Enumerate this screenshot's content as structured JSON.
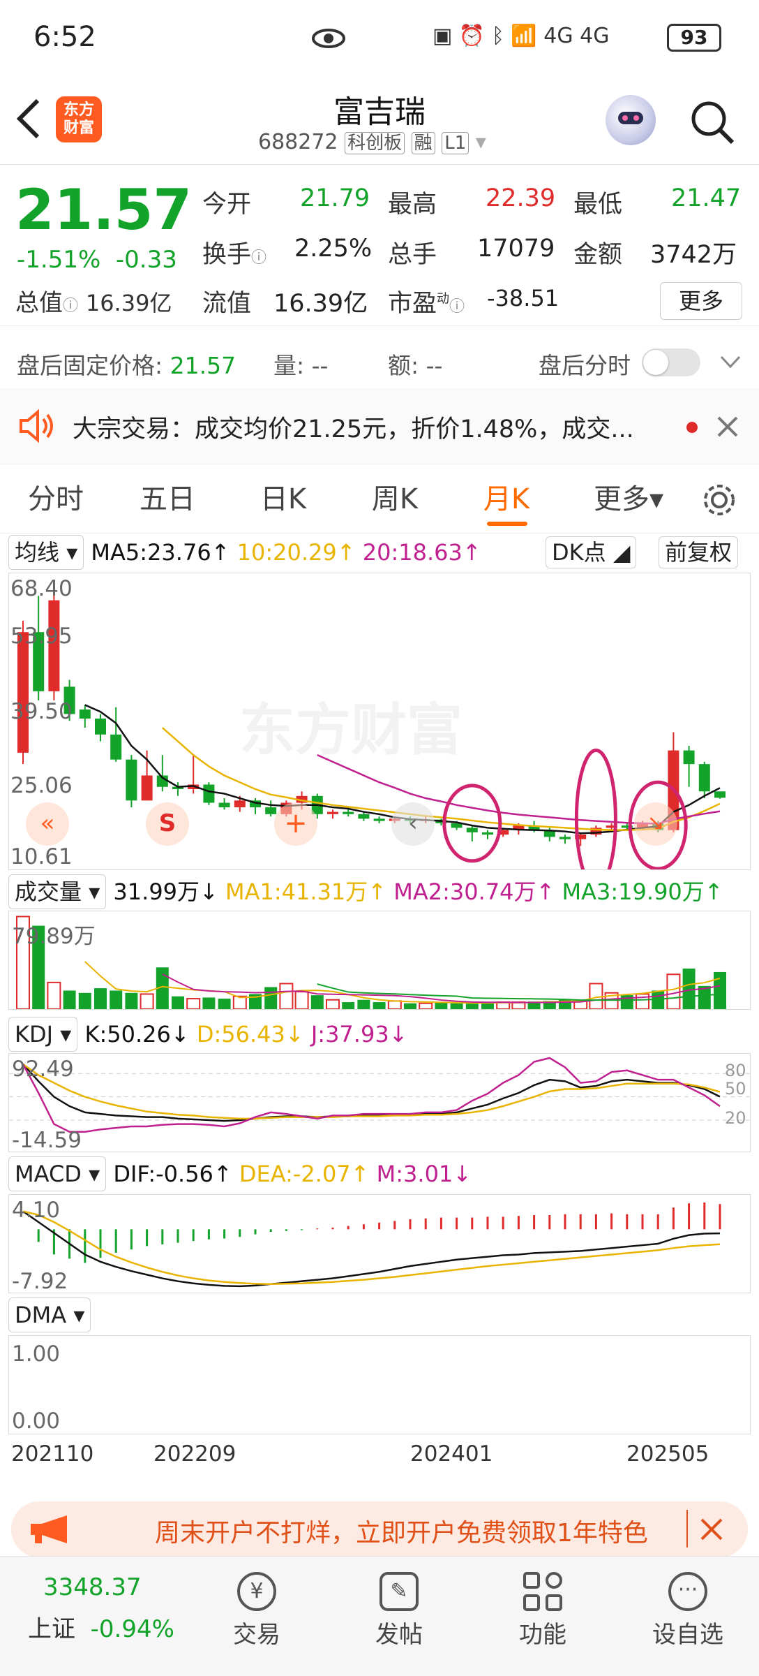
{
  "status": {
    "time": "6:52",
    "network": "4G",
    "battery": "93"
  },
  "header": {
    "title": "富吉瑞",
    "code": "688272",
    "tags": [
      "科创板",
      "融",
      "L1"
    ],
    "logo_text": "东方\n财富"
  },
  "quote": {
    "price": "21.57",
    "change_pct": "-1.51%",
    "change": "-0.33",
    "fields": [
      {
        "label": "今开",
        "value": "21.79",
        "color": "#13a32a"
      },
      {
        "label": "最高",
        "value": "22.39",
        "color": "#e02b2b"
      },
      {
        "label": "最低",
        "value": "21.47",
        "color": "#13a32a"
      },
      {
        "label": "换手",
        "value": "2.25%",
        "color": "#222"
      },
      {
        "label": "总手",
        "value": "17079",
        "color": "#222"
      },
      {
        "label": "金额",
        "value": "3742万",
        "color": "#222"
      },
      {
        "label": "总值",
        "value": "16.39亿",
        "color": "#222"
      },
      {
        "label": "流值",
        "value": "16.39亿",
        "color": "#222"
      },
      {
        "label": "市盈",
        "value": "-38.51",
        "color": "#222"
      }
    ],
    "pe_superscript": "动",
    "more_label": "更多"
  },
  "afterhours": {
    "fixed_label": "盘后固定价格:",
    "fixed_value": "21.57",
    "vol_label": "量:",
    "vol_value": "--",
    "amt_label": "额:",
    "amt_value": "--",
    "toggle_label": "盘后分时"
  },
  "notice": {
    "text": "大宗交易：成交均价21.25元，折价1.48%，成交..."
  },
  "tabs": [
    "分时",
    "五日",
    "日K",
    "周K",
    "月K",
    "更多▾"
  ],
  "active_tab": 4,
  "kline": {
    "ma_select": "均线",
    "ma5": "MA5:23.76↑",
    "ma10": "10:20.29↑",
    "ma20": "20:18.63↑",
    "dk_label": "DK点",
    "fq_label": "前复权",
    "y_labels": [
      "68.40",
      "53.95",
      "39.50",
      "25.06",
      "10.61"
    ],
    "watermark": "东方财富",
    "colors": {
      "up": "#e02b2b",
      "down": "#13a32a",
      "ma5": "#111111",
      "ma10": "#e8b400",
      "ma20": "#c0208f",
      "annot": "#d0246e"
    },
    "candles": [
      [
        31.5,
        58.0,
        29.0,
        60.5
      ],
      [
        58.0,
        45.0,
        43.0,
        66.0
      ],
      [
        45.0,
        65.0,
        43.0,
        67.0
      ],
      [
        46.0,
        40.0,
        38.5,
        47.5
      ],
      [
        41.0,
        39.0,
        37.0,
        42.0
      ],
      [
        39.0,
        35.5,
        34.0,
        40.0
      ],
      [
        35.5,
        30.0,
        29.5,
        41.5
      ],
      [
        30.0,
        21.0,
        19.5,
        31.0
      ],
      [
        21.0,
        26.5,
        21.0,
        32.0
      ],
      [
        26.5,
        24.0,
        23.0,
        31.0
      ],
      [
        24.0,
        23.5,
        22.0,
        25.0
      ],
      [
        23.5,
        24.5,
        22.5,
        31.0
      ],
      [
        24.5,
        20.5,
        20.0,
        25.0
      ],
      [
        20.5,
        19.5,
        19.0,
        21.5
      ],
      [
        19.5,
        21.0,
        18.5,
        22.0
      ],
      [
        21.0,
        19.5,
        18.0,
        21.5
      ],
      [
        19.5,
        18.0,
        17.5,
        21.0
      ],
      [
        18.0,
        20.5,
        17.5,
        21.0
      ],
      [
        20.5,
        22.0,
        19.0,
        23.0
      ],
      [
        22.0,
        18.0,
        17.0,
        22.5
      ],
      [
        18.0,
        18.5,
        17.0,
        19.0
      ],
      [
        18.5,
        18.0,
        17.5,
        19.5
      ],
      [
        18.0,
        17.0,
        16.5,
        18.5
      ],
      [
        17.0,
        16.5,
        16.0,
        17.5
      ],
      [
        16.5,
        17.0,
        16.0,
        17.5
      ],
      [
        17.0,
        16.5,
        16.0,
        17.5
      ],
      [
        16.5,
        16.8,
        16.0,
        17.5
      ],
      [
        16.8,
        16.0,
        15.5,
        17.0
      ],
      [
        16.0,
        15.0,
        14.5,
        16.5
      ],
      [
        15.0,
        14.0,
        12.0,
        15.5
      ],
      [
        14.0,
        13.5,
        12.5,
        14.5
      ],
      [
        13.5,
        14.5,
        13.0,
        15.0
      ],
      [
        14.5,
        15.5,
        13.5,
        16.0
      ],
      [
        15.5,
        14.5,
        14.0,
        16.5
      ],
      [
        14.5,
        13.0,
        12.0,
        15.0
      ],
      [
        13.0,
        12.5,
        11.5,
        13.5
      ],
      [
        12.5,
        13.5,
        11.0,
        14.0
      ],
      [
        13.5,
        15.0,
        13.0,
        15.5
      ],
      [
        15.0,
        15.5,
        14.0,
        16.0
      ],
      [
        15.5,
        15.0,
        14.5,
        16.0
      ],
      [
        15.0,
        16.0,
        14.5,
        16.5
      ],
      [
        16.0,
        14.5,
        14.0,
        16.5
      ],
      [
        14.5,
        32.0,
        14.0,
        36.0
      ],
      [
        32.0,
        29.0,
        24.0,
        33.0
      ],
      [
        29.0,
        23.0,
        21.5,
        29.5
      ],
      [
        23.0,
        21.6,
        21.4,
        22.4
      ]
    ],
    "ma5_line": [
      null,
      null,
      null,
      null,
      42.0,
      40.5,
      38.0,
      33.0,
      30.0,
      26.0,
      24.0,
      24.2,
      23.0,
      22.5,
      21.5,
      20.5,
      20.0,
      19.8,
      20.0,
      20.0,
      19.5,
      19.2,
      18.5,
      18.0,
      17.3,
      16.9,
      16.7,
      16.5,
      16.2,
      15.5,
      15.0,
      14.8,
      14.6,
      14.5,
      14.4,
      14.2,
      13.8,
      13.9,
      14.2,
      14.6,
      15.0,
      15.3,
      18.5,
      20.0,
      22.0,
      23.76
    ],
    "ma10_line": [
      null,
      null,
      null,
      null,
      null,
      null,
      null,
      null,
      null,
      37.0,
      34.0,
      31.0,
      28.5,
      26.5,
      25.0,
      23.5,
      22.3,
      21.7,
      21.0,
      20.5,
      20.0,
      19.6,
      19.2,
      18.8,
      18.4,
      18.0,
      17.6,
      17.3,
      17.0,
      16.6,
      16.2,
      15.9,
      15.6,
      15.4,
      15.2,
      15.0,
      14.8,
      14.6,
      14.5,
      14.5,
      14.6,
      14.8,
      16.3,
      17.3,
      18.7,
      20.29
    ],
    "ma20_line": [
      null,
      null,
      null,
      null,
      null,
      null,
      null,
      null,
      null,
      null,
      null,
      null,
      null,
      null,
      null,
      null,
      null,
      null,
      null,
      31.0,
      29.5,
      28.0,
      26.5,
      25.0,
      23.8,
      22.5,
      21.5,
      20.8,
      20.0,
      19.4,
      18.8,
      18.3,
      17.9,
      17.6,
      17.3,
      17.0,
      16.7,
      16.5,
      16.3,
      16.1,
      16.0,
      15.9,
      16.9,
      17.5,
      18.1,
      18.63
    ]
  },
  "volume": {
    "select": "成交量",
    "value": "31.99万↓",
    "ma1": "MA1:41.31万↑",
    "ma2": "MA2:30.74万↑",
    "ma3": "MA3:19.90万↑",
    "y_top": "79.89万",
    "bars": [
      79.9,
      72.0,
      23.0,
      16.0,
      14.0,
      18.0,
      16.0,
      14.0,
      13.0,
      36.0,
      11.0,
      9.0,
      10.0,
      9.0,
      11.0,
      13.0,
      19.0,
      22.0,
      15.0,
      12.0,
      8.0,
      6.0,
      8.0,
      6.0,
      7.0,
      5.0,
      5.0,
      6.0,
      5.0,
      5.0,
      5.5,
      6.0,
      6.0,
      6.5,
      7.0,
      8.0,
      7.0,
      22.0,
      14.0,
      12.0,
      13.0,
      16.0,
      30.0,
      35.0,
      20.0,
      31.99
    ]
  },
  "kdj": {
    "select": "KDJ",
    "k": "K:50.26↓",
    "d": "D:56.43↓",
    "j": "J:37.93↓",
    "y_top": "92.49",
    "y_bottom": "-14.59",
    "right_labels": [
      "80",
      "50",
      "20"
    ],
    "k_line": [
      92,
      70,
      50,
      38,
      30,
      28,
      26,
      25,
      24,
      24,
      22,
      21,
      20,
      19,
      20,
      22,
      24,
      25,
      25,
      24,
      25,
      25,
      26,
      26,
      27,
      27,
      28,
      28,
      30,
      35,
      40,
      48,
      55,
      65,
      72,
      70,
      62,
      64,
      70,
      72,
      70,
      68,
      68,
      65,
      60,
      50.26
    ],
    "d_line": [
      92,
      78,
      68,
      58,
      50,
      44,
      39,
      35,
      31,
      29,
      27,
      26,
      24,
      23,
      22,
      22,
      23,
      24,
      24,
      24,
      24,
      25,
      25,
      25,
      26,
      26,
      27,
      27,
      28,
      30,
      33,
      38,
      44,
      50,
      57,
      60,
      60,
      61,
      64,
      67,
      67,
      67,
      67,
      66,
      62,
      56.43
    ],
    "j_line": [
      92,
      55,
      15,
      5,
      5,
      8,
      10,
      12,
      12,
      14,
      15,
      15,
      14,
      12,
      16,
      24,
      30,
      28,
      25,
      22,
      26,
      26,
      28,
      28,
      28,
      28,
      30,
      30,
      33,
      45,
      54,
      68,
      78,
      95,
      100,
      88,
      68,
      70,
      82,
      84,
      78,
      72,
      72,
      62,
      52,
      37.93
    ]
  },
  "macd": {
    "select": "MACD",
    "dif": "DIF:-0.56↑",
    "dea": "DEA:-2.07↑",
    "m": "M:3.01↓",
    "y_top": "4.10",
    "y_bottom": "-7.92",
    "dif_line": [
      2.5,
      1.0,
      -0.5,
      -2.0,
      -3.5,
      -4.5,
      -5.2,
      -5.8,
      -6.3,
      -6.8,
      -7.2,
      -7.5,
      -7.7,
      -7.85,
      -7.9,
      -7.8,
      -7.6,
      -7.4,
      -7.2,
      -7.0,
      -6.8,
      -6.5,
      -6.2,
      -5.9,
      -5.5,
      -5.1,
      -4.8,
      -4.5,
      -4.2,
      -4.0,
      -3.8,
      -3.6,
      -3.5,
      -3.3,
      -3.2,
      -3.1,
      -3.0,
      -2.8,
      -2.6,
      -2.4,
      -2.2,
      -2.0,
      -1.3,
      -0.8,
      -0.6,
      -0.56
    ],
    "dea_line": [
      2.5,
      2.0,
      1.0,
      -0.2,
      -1.5,
      -2.8,
      -3.8,
      -4.6,
      -5.3,
      -5.9,
      -6.4,
      -6.8,
      -7.1,
      -7.3,
      -7.45,
      -7.55,
      -7.6,
      -7.55,
      -7.5,
      -7.4,
      -7.3,
      -7.15,
      -7.0,
      -6.8,
      -6.6,
      -6.35,
      -6.1,
      -5.85,
      -5.6,
      -5.35,
      -5.1,
      -4.9,
      -4.7,
      -4.5,
      -4.3,
      -4.1,
      -3.9,
      -3.7,
      -3.5,
      -3.3,
      -3.1,
      -2.9,
      -2.6,
      -2.35,
      -2.2,
      -2.07
    ],
    "hist": [
      0,
      -1.5,
      -3,
      -3.5,
      -4,
      -3.4,
      -2.8,
      -2.4,
      -2.0,
      -1.8,
      -1.6,
      -1.4,
      -1.2,
      -1.1,
      -0.9,
      -0.6,
      -0.3,
      -0.2,
      -0.1,
      0.1,
      0.2,
      0.4,
      0.6,
      0.8,
      1.0,
      1.2,
      1.3,
      1.4,
      1.4,
      1.4,
      1.5,
      1.5,
      1.6,
      1.7,
      1.7,
      1.8,
      1.8,
      1.8,
      1.9,
      1.8,
      1.8,
      1.8,
      2.6,
      3.1,
      3.2,
      3.01
    ]
  },
  "dma": {
    "select": "DMA",
    "y_top": "1.00",
    "y_bottom": "0.00"
  },
  "x_labels": [
    "202110",
    "202209",
    "202401",
    "202505"
  ],
  "promo": {
    "text": "周末开户不打烊，立即开户免费领取1年特色"
  },
  "bottom_nav": {
    "index_value": "3348.37",
    "index_name": "上证",
    "index_change": "-0.94%",
    "items": [
      "交易",
      "发帖",
      "功能",
      "设自选"
    ]
  }
}
